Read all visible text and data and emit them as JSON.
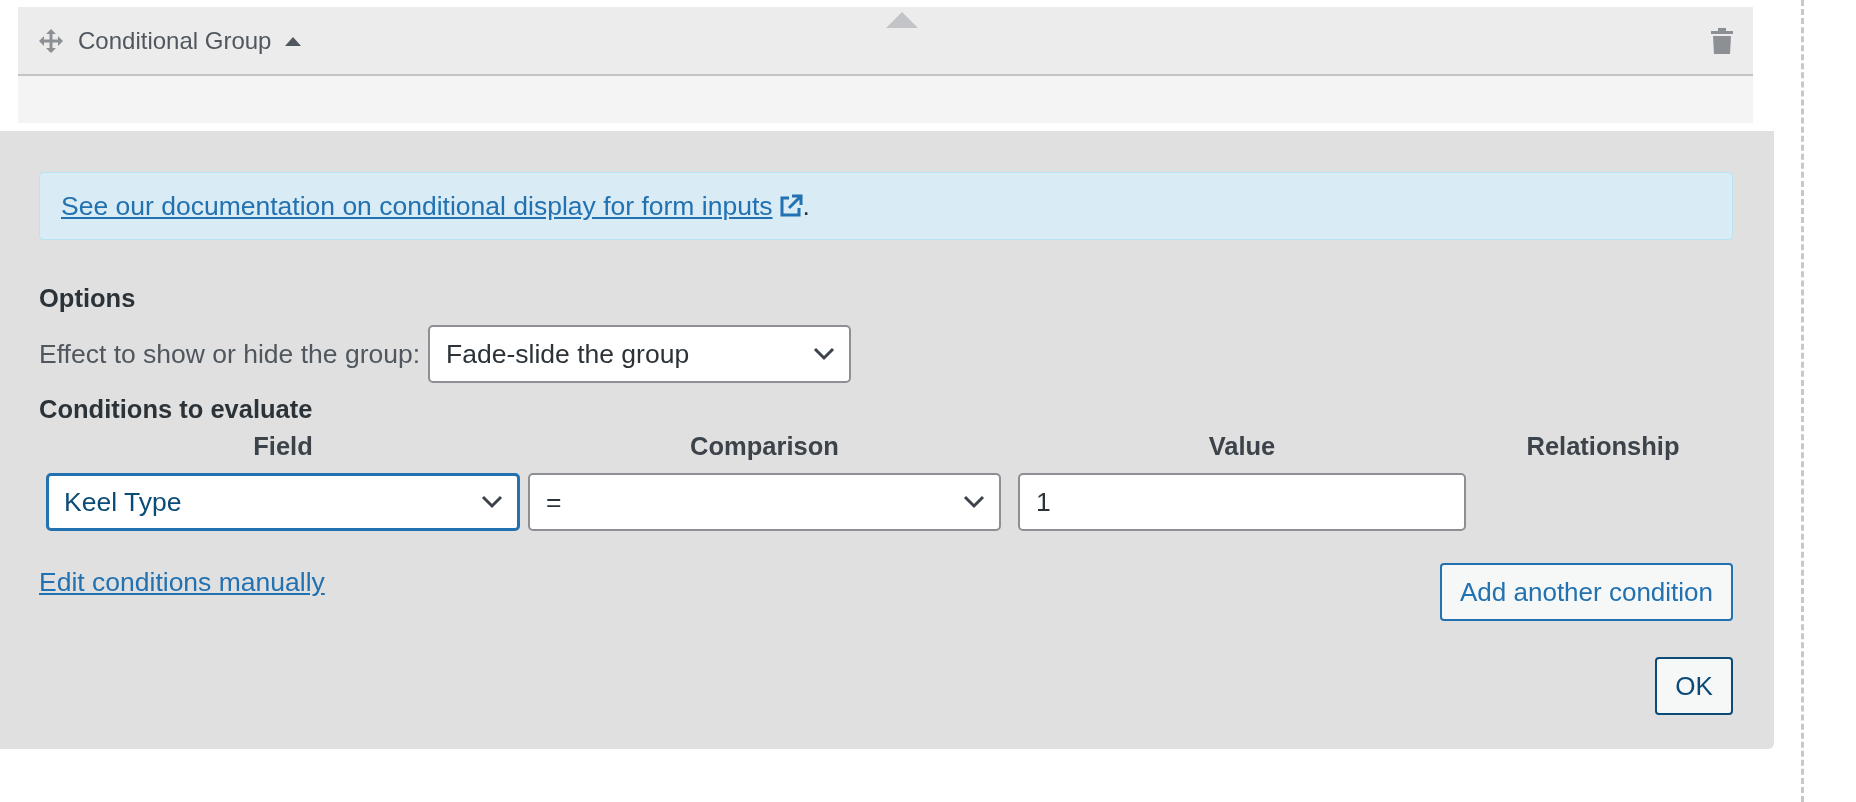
{
  "group_header": {
    "title": "Conditional Group",
    "expanded": true
  },
  "notice": {
    "link": "See our documentation on conditional display for form inputs",
    "suffix": "."
  },
  "options": {
    "heading": "Options",
    "effect_label": "Effect to show or hide the group:",
    "effect_value": "Fade-slide the group"
  },
  "conditions": {
    "heading": "Conditions to evaluate",
    "columns": [
      "Field",
      "Comparison",
      "Value",
      "Relationship"
    ],
    "rows": [
      {
        "field": "Keel Type",
        "field_focused": true,
        "comparison": "=",
        "value": "1"
      }
    ]
  },
  "edit_link": "Edit conditions manually",
  "add_button": "Add another condition",
  "ok_button": "OK"
}
